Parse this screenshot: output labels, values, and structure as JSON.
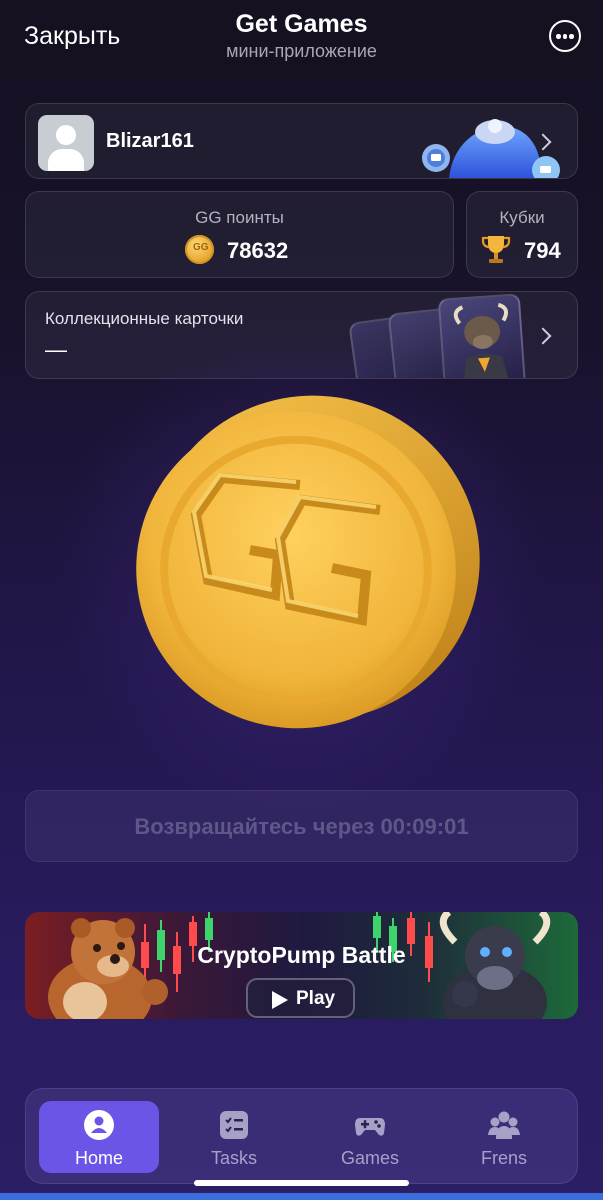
{
  "topbar": {
    "close_label": "Закрыть",
    "title": "Get Games",
    "subtitle": "мини-приложение",
    "more_icon": "more-dots-icon"
  },
  "profile": {
    "username": "Blizar161",
    "avatar_icon": "user-avatar-icon",
    "art_icon": "wallet-coins-icon"
  },
  "stats": {
    "points_label": "GG поинты",
    "points_value": "78632",
    "cups_label": "Кубки",
    "cups_value": "794"
  },
  "collection": {
    "title": "Коллекционные карточки",
    "count": "—"
  },
  "main": {
    "coin_icon": "gg-coin-icon",
    "timer_text": "Возвращайтесь через 00:09:01"
  },
  "banner": {
    "title": "CryptoPump Battle",
    "play_label": "Play"
  },
  "nav": {
    "items": [
      {
        "label": "Home",
        "icon": "home-icon",
        "active": true
      },
      {
        "label": "Tasks",
        "icon": "tasks-icon",
        "active": false
      },
      {
        "label": "Games",
        "icon": "gamepad-icon",
        "active": false
      },
      {
        "label": "Frens",
        "icon": "friends-icon",
        "active": false
      }
    ]
  },
  "colors": {
    "accent": "#6a55e6",
    "coin": "#f2b63a",
    "background": "#1b1433"
  }
}
